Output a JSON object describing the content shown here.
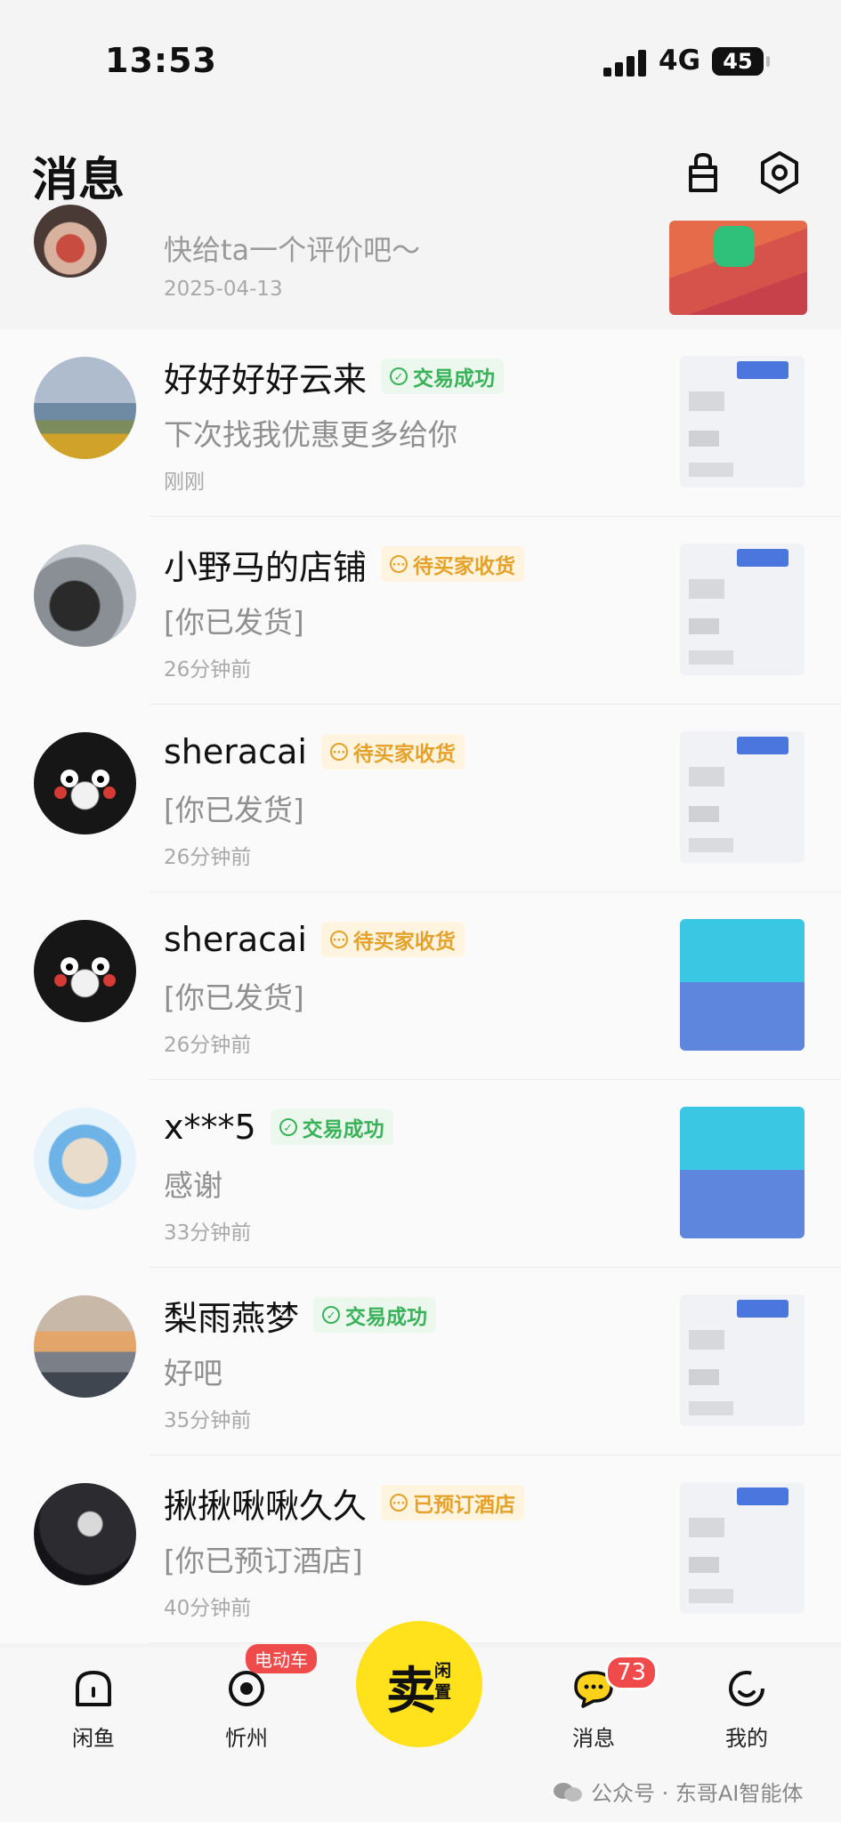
{
  "status_bar": {
    "time": "13:53",
    "network": "4G",
    "battery": "45"
  },
  "header": {
    "title": "消息"
  },
  "top_item": {
    "message": "快给ta一个评价吧～",
    "time": "2025-04-13"
  },
  "conversations": [
    {
      "name": "好好好好云来",
      "badge": "交易成功",
      "badge_type": "green",
      "message": "下次找我优惠更多给你",
      "time": "刚刚",
      "avatar": "landscape",
      "thumb": "doc"
    },
    {
      "name": "小野马的店铺",
      "badge": "待买家收货",
      "badge_type": "orange",
      "message": "[你已发货]",
      "time": "26分钟前",
      "avatar": "person",
      "thumb": "doc"
    },
    {
      "name": "sheracai",
      "badge": "待买家收货",
      "badge_type": "orange",
      "message": "[你已发货]",
      "time": "26分钟前",
      "avatar": "bear",
      "thumb": "doc"
    },
    {
      "name": "sheracai",
      "badge": "待买家收货",
      "badge_type": "orange",
      "message": "[你已发货]",
      "time": "26分钟前",
      "avatar": "bear",
      "thumb": "blue"
    },
    {
      "name": "x***5",
      "badge": "交易成功",
      "badge_type": "green",
      "message": "感谢",
      "time": "33分钟前",
      "avatar": "seal",
      "thumb": "blue"
    },
    {
      "name": "梨雨燕梦",
      "badge": "交易成功",
      "badge_type": "green",
      "message": "好吧",
      "time": "35分钟前",
      "avatar": "sunset",
      "thumb": "doc"
    },
    {
      "name": "揪揪啾啾久久",
      "badge": "已预订酒店",
      "badge_type": "orange",
      "message": "[你已预订酒店]",
      "time": "40分钟前",
      "avatar": "singer",
      "thumb": "doc"
    }
  ],
  "bottom_nav": {
    "home": "闲鱼",
    "city": "忻州",
    "city_tag": "电动车",
    "sell_main": "卖",
    "sell_sub": "闲置",
    "messages": "消息",
    "messages_count": "73",
    "mine": "我的"
  },
  "watermark": "公众号 · 东哥AI智能体",
  "colors": {
    "accent_yellow": "#ffe21c",
    "badge_red": "#ef4b4b",
    "success_green": "#39b25a",
    "pending_orange": "#e4a22a"
  }
}
